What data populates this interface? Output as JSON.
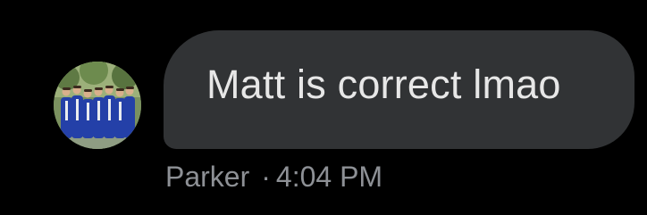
{
  "message": {
    "text": "Matt is correct lmao",
    "sender": "Parker",
    "separator": "·",
    "time": "4:04 PM"
  },
  "colors": {
    "background": "#000000",
    "bubble": "#313335",
    "text": "#e7e7e7",
    "meta": "#8d9095"
  },
  "icons": {
    "avatar": "group-photo-graduates"
  }
}
